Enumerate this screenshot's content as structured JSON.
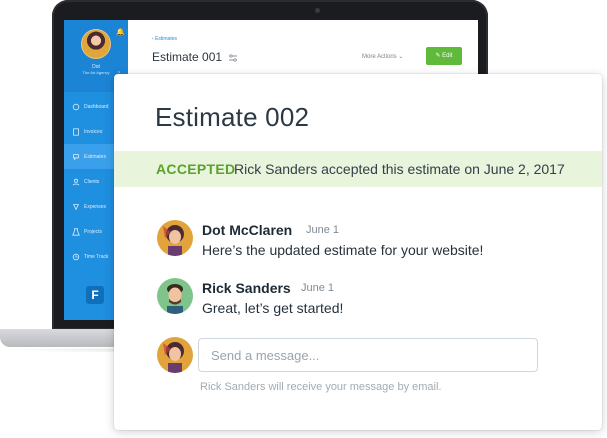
{
  "laptop_app": {
    "sidebar": {
      "user_name": "Dot",
      "org_name": "The Art Agency",
      "items": [
        {
          "label": "Dashboard",
          "icon": "dashboard-icon",
          "active": false
        },
        {
          "label": "Invoices",
          "icon": "invoice-icon",
          "active": false
        },
        {
          "label": "Estimates",
          "icon": "estimate-icon",
          "active": true
        },
        {
          "label": "Clients",
          "icon": "clients-icon",
          "active": false
        },
        {
          "label": "Expenses",
          "icon": "expenses-icon",
          "active": false
        },
        {
          "label": "Projects",
          "icon": "projects-icon",
          "active": false
        },
        {
          "label": "Time Track",
          "icon": "time-icon",
          "active": false
        }
      ],
      "logo_letter": "F"
    },
    "header": {
      "breadcrumb": "‹ Estimates",
      "title": "Estimate 001",
      "more_actions": "More Actions",
      "edit_label": "Edit"
    }
  },
  "card": {
    "title": "Estimate 002",
    "status": {
      "label": "ACCEPTED",
      "text": "Rick Sanders accepted this estimate on June 2, 2017"
    },
    "messages": [
      {
        "author": "Dot McClaren",
        "date": "June 1",
        "body": "Here’s the updated estimate for your website!"
      },
      {
        "author": "Rick Sanders",
        "date": "June 1",
        "body": "Great, let’s get started!"
      }
    ],
    "composer": {
      "placeholder": "Send a message...",
      "value": "",
      "hint": "Rick Sanders will receive your message by email."
    }
  },
  "colors": {
    "sidebar_blue": "#1f8fe0",
    "accepted_green": "#5aa32b",
    "banner_green": "#e8f4dc",
    "edit_green": "#5fb93a"
  }
}
